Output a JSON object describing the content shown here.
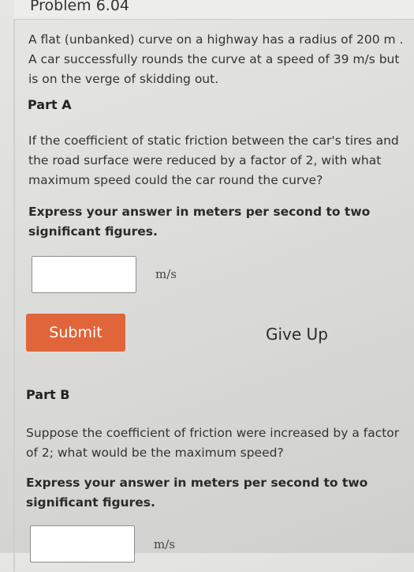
{
  "problem": {
    "title": "Problem 6.04",
    "intro": "A flat (unbanked) curve on a highway has a radius of 200 m . A car successfully rounds the curve at a speed of 39 m/s but is on the verge of skidding out."
  },
  "part_a": {
    "label": "Part A",
    "question": "If the coefficient of static friction between the car's tires and the road surface were reduced by a factor of 2, with what maximum speed could the car round the curve?",
    "instruction": "Express your answer in meters per second to two significant figures.",
    "answer_value": "",
    "unit": "m/s",
    "submit_label": "Submit",
    "give_up_label": "Give Up"
  },
  "part_b": {
    "label": "Part B",
    "question": "Suppose the coefficient of friction were increased by a factor of 2; what would be the maximum speed?",
    "instruction": "Express your answer in meters per second to two significant figures.",
    "answer_value": "",
    "unit": "m/s"
  },
  "colors": {
    "submit_button": "#e0653a",
    "page_background": "#dcdcda"
  }
}
